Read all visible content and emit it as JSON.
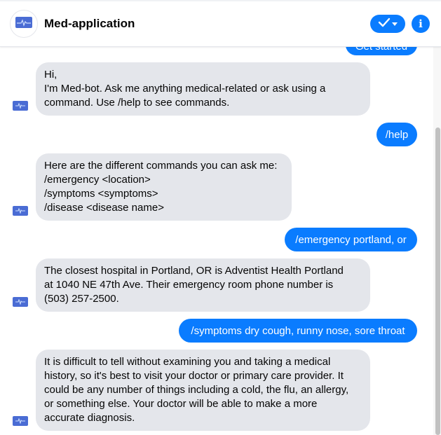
{
  "app": {
    "title": "Med-application",
    "icons": {
      "logo": "heartbeat-monitor-icon",
      "check": "checkmark-icon",
      "info": "info-icon"
    },
    "info_glyph": "i"
  },
  "colors": {
    "user_bubble": "#0a7cff",
    "bot_bubble": "#e4e6eb",
    "accent": "#0a7cff"
  },
  "messages": [
    {
      "sender": "user",
      "text": "Get started",
      "partial": true
    },
    {
      "sender": "bot",
      "text": "Hi,\nI'm Med-bot. Ask me anything medical-related or ask using a\ncommand. Use /help to see commands."
    },
    {
      "sender": "user",
      "text": "/help"
    },
    {
      "sender": "bot",
      "text": "Here are the different commands you can ask me:\n/emergency <location>\n/symptoms <symptoms>\n/disease <disease name>"
    },
    {
      "sender": "user",
      "text": "/emergency portland, or"
    },
    {
      "sender": "bot",
      "text": "The closest hospital in Portland, OR is Adventist Health Portland\nat 1040 NE 47th Ave. Their emergency room phone number is\n(503) 257-2500."
    },
    {
      "sender": "user",
      "text": "/symptoms dry cough, runny nose, sore throat"
    },
    {
      "sender": "bot",
      "text": "It is difficult to tell without examining you and taking a medical\nhistory, so it's best to visit your doctor or primary care provider. It\ncould be any number of things including a cold, the flu, an allergy,\nor something else. Your doctor will be able to make a more\naccurate diagnosis."
    }
  ]
}
